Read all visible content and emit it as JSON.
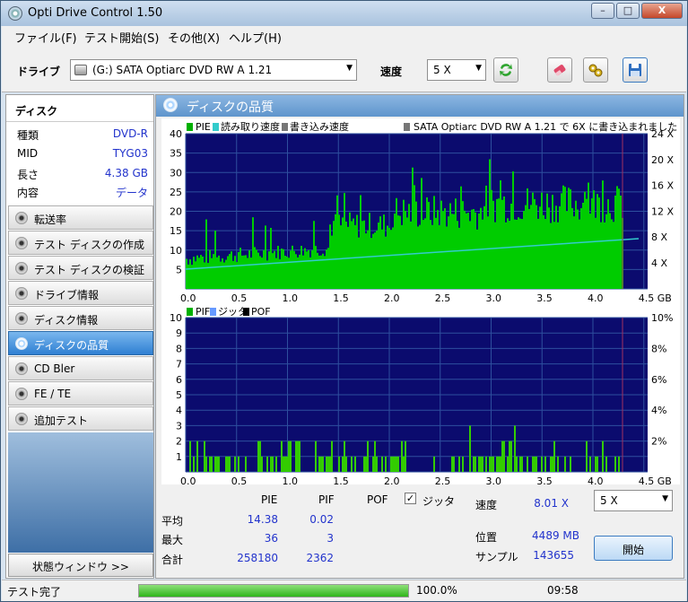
{
  "window": {
    "title": "Opti Drive Control 1.50",
    "minimize": "–",
    "maximize": "□",
    "close": "X"
  },
  "menu": [
    "ファイル(F)",
    "テスト開始(S)",
    "その他(X)",
    "ヘルプ(H)"
  ],
  "toolbar": {
    "drive_label": "ドライブ",
    "drive_value": "(G:)   SATA Optiarc DVD RW A 1.21",
    "speed_label": "速度",
    "speed_value": "5 X"
  },
  "disc": {
    "header": "ディスク",
    "rows": [
      {
        "key": "種類",
        "value": "DVD-R"
      },
      {
        "key": "MID",
        "value": "TYG03"
      },
      {
        "key": "長さ",
        "value": "4.38 GB"
      },
      {
        "key": "内容",
        "value": "データ"
      }
    ]
  },
  "nav": [
    {
      "label": "転送率",
      "active": false
    },
    {
      "label": "テスト ディスクの作成",
      "active": false
    },
    {
      "label": "テスト ディスクの検証",
      "active": false
    },
    {
      "label": "ドライブ情報",
      "active": false
    },
    {
      "label": "ディスク情報",
      "active": false
    },
    {
      "label": "ディスクの品質",
      "active": true
    },
    {
      "label": "CD Bler",
      "active": false
    },
    {
      "label": "FE / TE",
      "active": false
    },
    {
      "label": "追加テスト",
      "active": false
    }
  ],
  "status_window_button": "状態ウィンドウ >>",
  "quality": {
    "header": "ディスクの品質",
    "top_chart": {
      "legend": [
        "PIE",
        "読み取り速度",
        "書き込み速度"
      ],
      "note": "SATA Optiarc DVD RW A 1.21 で 6X に書き込まれました",
      "y_ticks": [
        "40",
        "35",
        "30",
        "25",
        "20",
        "15",
        "10",
        "5"
      ],
      "y2_ticks": [
        "24 X",
        "20 X",
        "16 X",
        "12 X",
        "8 X",
        "4 X"
      ],
      "x_ticks": [
        "0.0",
        "0.5",
        "1.0",
        "1.5",
        "2.0",
        "2.5",
        "3.0",
        "3.5",
        "4.0",
        "4.5 GB"
      ]
    },
    "bottom_chart": {
      "legend": [
        "PIF",
        "ジッタ",
        "POF"
      ],
      "y_ticks": [
        "10",
        "9",
        "8",
        "7",
        "6",
        "5",
        "4",
        "3",
        "2",
        "1"
      ],
      "y2_ticks": [
        "10%",
        "8%",
        "6%",
        "4%",
        "2%"
      ],
      "x_ticks": [
        "0.0",
        "0.5",
        "1.0",
        "1.5",
        "2.0",
        "2.5",
        "3.0",
        "3.5",
        "4.0",
        "4.5 GB"
      ]
    },
    "stats": {
      "col_pie": "PIE",
      "col_pif": "PIF",
      "col_pof": "POF",
      "jitter_label": "ジッタ",
      "avg_label": "平均",
      "avg_pie": "14.38",
      "avg_pif": "0.02",
      "max_label": "最大",
      "max_pie": "36",
      "max_pif": "3",
      "total_label": "合計",
      "total_pie": "258180",
      "total_pif": "2362",
      "speed_label": "速度",
      "speed_value": "8.01 X",
      "speed_select": "5 X",
      "pos_label": "位置",
      "pos_value": "4489 MB",
      "sample_label": "サンプル",
      "sample_value": "143655",
      "start_button": "開始"
    }
  },
  "colors": {
    "plot_bg": "#0b0b6e",
    "grid": "#2e4f9e",
    "pie": "#00cc00",
    "speed": "#33cccc",
    "accent": "#2233cc"
  },
  "statusbar": {
    "text": "テスト完了",
    "progress": "100.0%",
    "progress_fraction": 1.0,
    "time": "09:58"
  }
}
